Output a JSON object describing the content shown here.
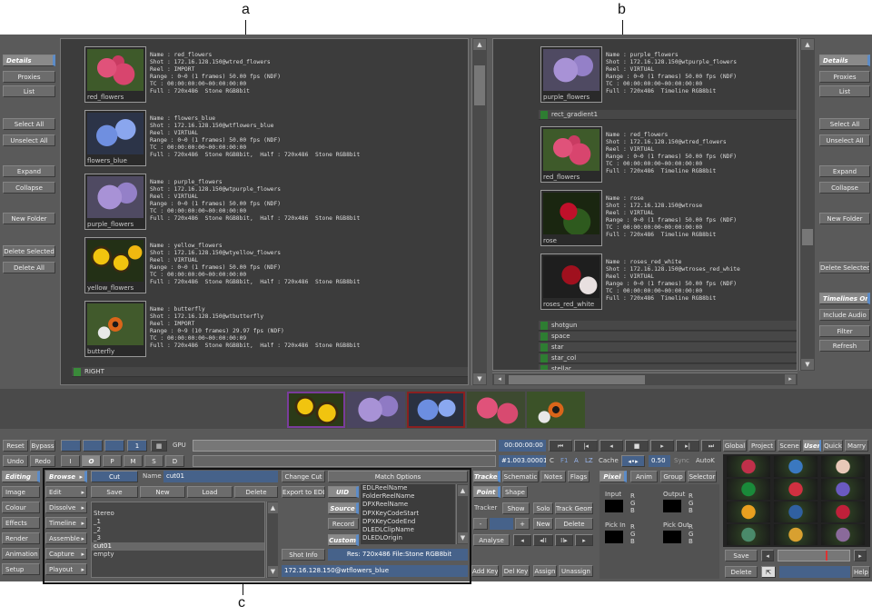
{
  "callouts": {
    "a": "a",
    "b": "b",
    "c": "c"
  },
  "left_sidebar": [
    "Details",
    "Proxies",
    "List",
    "Select All",
    "Unselect All",
    "Expand",
    "Collapse",
    "New Folder",
    "Delete Selected",
    "Delete All"
  ],
  "right_sidebar": [
    "Details",
    "Proxies",
    "List",
    "Select All",
    "Unselect All",
    "Expand",
    "Collapse",
    "New Folder",
    "Delete Selected",
    "Timelines Only",
    "Include Audio",
    "Filter",
    "Refresh"
  ],
  "left_clips": [
    {
      "caption": "red_flowers",
      "meta": "Name : red_flowers\nShot : 172.16.128.150@wtred_flowers\nReel : IMPORT\nRange : 0~0 (1 frames) 50.00 fps (NDF)\nTC : 00:00:00:00~00:00:00:00\nFull : 720x486  Stone RGB8bit"
    },
    {
      "caption": "flowers_blue",
      "meta": "Name : flowers_blue\nShot : 172.16.128.150@wtflowers_blue\nReel : VIRTUAL\nRange : 0~0 (1 frames) 50.00 fps (NDF)\nTC : 00:00:00:00~00:00:00:00\nFull : 720x486  Stone RGB8bit,  Half : 720x486  Stone RGB8bit"
    },
    {
      "caption": "purple_flowers",
      "meta": "Name : purple_flowers\nShot : 172.16.128.150@wtpurple_flowers\nReel : VIRTUAL\nRange : 0~0 (1 frames) 50.00 fps (NDF)\nTC : 00:00:00:00~00:00:00:00\nFull : 720x486  Stone RGB8bit,  Half : 720x486  Stone RGB8bit"
    },
    {
      "caption": "yellow_flowers",
      "meta": "Name : yellow_flowers\nShot : 172.16.128.150@wtyellow_flowers\nReel : VIRTUAL\nRange : 0~0 (1 frames) 50.00 fps (NDF)\nTC : 00:00:00:00~00:00:00:00\nFull : 720x486  Stone RGB8bit,  Half : 720x486  Stone RGB8bit"
    },
    {
      "caption": "butterfly",
      "meta": "Name : butterfly\nShot : 172.16.128.150@wtbutterfly\nReel : IMPORT\nRange : 0~9 (10 frames) 29.97 fps (NDF)\nTC : 00:00:00:00~00:00:00:09\nFull : 720x486  Stone RGB8bit,  Half : 720x486  Stone RGB8bit"
    }
  ],
  "left_folder": "RIGHT",
  "right_clips": [
    {
      "caption": "purple_flowers",
      "meta": "Name : purple_flowers\nShot : 172.16.128.150@wtpurple_flowers\nReel : VIRTUAL\nRange : 0~0 (1 frames) 50.00 fps (NDF)\nTC : 00:00:00:00~00:00:00:00\nFull : 720x486  Timeline RGB8bit"
    },
    {
      "caption": "red_flowers",
      "meta": "Name : red_flowers\nShot : 172.16.128.150@wtred_flowers\nReel : VIRTUAL\nRange : 0~0 (1 frames) 50.00 fps (NDF)\nTC : 00:00:00:00~00:00:00:00\nFull : 720x486  Timeline RGB8bit"
    },
    {
      "caption": "rose",
      "meta": "Name : rose\nShot : 172.16.128.150@wtrose\nReel : VIRTUAL\nRange : 0~0 (1 frames) 50.00 fps (NDF)\nTC : 00:00:00:00~00:00:00:00\nFull : 720x486  Timeline RGB8bit"
    },
    {
      "caption": "roses_red_white",
      "meta": "Name : roses_red_white\nShot : 172.16.128.150@wtroses_red_white\nReel : VIRTUAL\nRange : 0~0 (1 frames) 50.00 fps (NDF)\nTC : 00:00:00:00~00:00:00:00\nFull : 720x486  Timeline RGB8bit"
    }
  ],
  "right_gradient_row": "rect_gradient1",
  "right_rows": [
    "shotgun",
    "space",
    "star",
    "star_col",
    "stellar"
  ],
  "transport": {
    "reset": "Reset",
    "bypass": "Bypass",
    "frame": "1",
    "gpu": "GPU",
    "timecode": "00:00:00:00",
    "undo": "Undo",
    "redo": "Redo",
    "modes": [
      "I",
      "O",
      "P",
      "M",
      "S",
      "D"
    ],
    "frame_rate": "#1.003.00001",
    "c": "C",
    "f1": "F1",
    "a": "A",
    "lz": "LZ",
    "cache": "Cache",
    "value": "0.50",
    "sync": "Sync",
    "autok": "AutoK"
  },
  "modes": [
    "Editing",
    "Image",
    "Colour",
    "Effects",
    "Render",
    "Animation",
    "Setup"
  ],
  "editing_menu": [
    "Browse",
    "Edit",
    "Dissolve",
    "Timeline",
    "Assemble",
    "Capture",
    "Playout"
  ],
  "browse": {
    "cut": "Cut",
    "name_label": "Name",
    "name_value": "cut01",
    "save": "Save",
    "new": "New",
    "load": "Load",
    "delete": "Delete",
    "list": [
      "Stereo",
      "_1",
      "_2",
      "_3",
      "cut01",
      "empty"
    ],
    "change_cut": "Change Cut",
    "match_options": "Match Options",
    "export_edl": "Export to EDL",
    "uid": "UID",
    "source": "Source",
    "record": "Record",
    "custom": "Custom",
    "match_fields": [
      "EDLReelName",
      "FolderReelName",
      "DPXReelName",
      "DPXKeyCodeStart",
      "DPXKeyCodeEnd",
      "DLEDLClipName",
      "DLEDLOrigin"
    ],
    "shot_info": "Shot Info",
    "res": "Res: 720x486 File:Stone RGB8bit",
    "path": "172.16.128.150@wtflowers_blue"
  },
  "tracker": {
    "tabs": [
      "Tracker",
      "Schematic",
      "Notes",
      "Flags"
    ],
    "point": "Point",
    "shape": "Shape",
    "tracker_lbl": "Tracker",
    "show": "Show",
    "solo": "Solo",
    "track_geom": "Track Geom",
    "minus": "-",
    "plus": "+",
    "new": "New",
    "delete": "Delete",
    "analyse": "Analyse",
    "add_key": "Add Key",
    "del_key": "Del Key",
    "assign": "Assign",
    "unassign": "Unassign"
  },
  "pixel": {
    "tabs": [
      "Pixel",
      "Anim",
      "Group",
      "Selector"
    ],
    "input": "Input",
    "output": "Output",
    "pick_in": "Pick In",
    "pick_out": "Pick Out",
    "rgb": [
      "R",
      "G",
      "B"
    ]
  },
  "gallery": {
    "tabs": [
      "Global",
      "Project",
      "Scene",
      "User",
      "Quick",
      "Marry"
    ],
    "save": "Save",
    "delete": "Delete",
    "help": "Help"
  }
}
